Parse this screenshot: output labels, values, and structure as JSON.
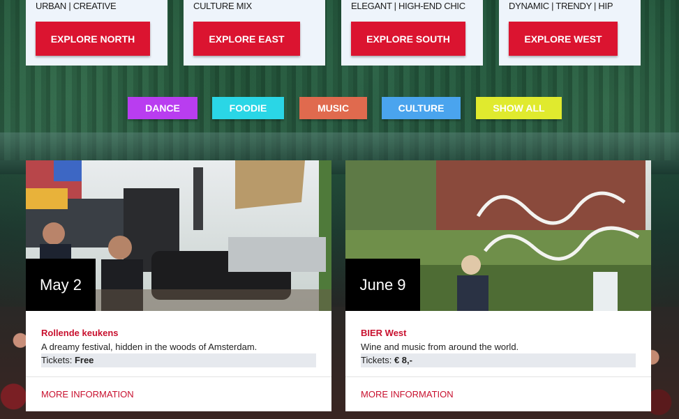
{
  "regions": [
    {
      "tag": "URBAN | CREATIVE",
      "button": "EXPLORE NORTH"
    },
    {
      "tag": "CULTURE MIX",
      "button": "EXPLORE EAST"
    },
    {
      "tag": "ELEGANT | HIGH-END CHIC",
      "button": "EXPLORE SOUTH"
    },
    {
      "tag": "DYNAMIC | TRENDY | HIP",
      "button": "EXPLORE WEST"
    }
  ],
  "filters": [
    {
      "label": "DANCE",
      "color": "#b93df0"
    },
    {
      "label": "FOODIE",
      "color": "#2ad6e6"
    },
    {
      "label": "MUSIC",
      "color": "#e06a4e"
    },
    {
      "label": "CULTURE",
      "color": "#4aa4ee"
    },
    {
      "label": "SHOW ALL",
      "color": "#e0ea2e"
    }
  ],
  "events": [
    {
      "date": "May 2",
      "title": "Rollende keukens",
      "description": "A dreamy festival, hidden in the woods of Amsterdam.",
      "tickets_label": "Tickets:",
      "tickets_value": "Free",
      "more": "MORE INFORMATION"
    },
    {
      "date": "June 9",
      "title": "BIER West",
      "description": "Wine and music from around the world.",
      "tickets_label": "Tickets:",
      "tickets_value": "€ 8,-",
      "more": "MORE INFORMATION"
    }
  ],
  "colors": {
    "accent_red": "#db1430",
    "link_red": "#c8102e",
    "region_card_bg": "#eef4fb"
  }
}
